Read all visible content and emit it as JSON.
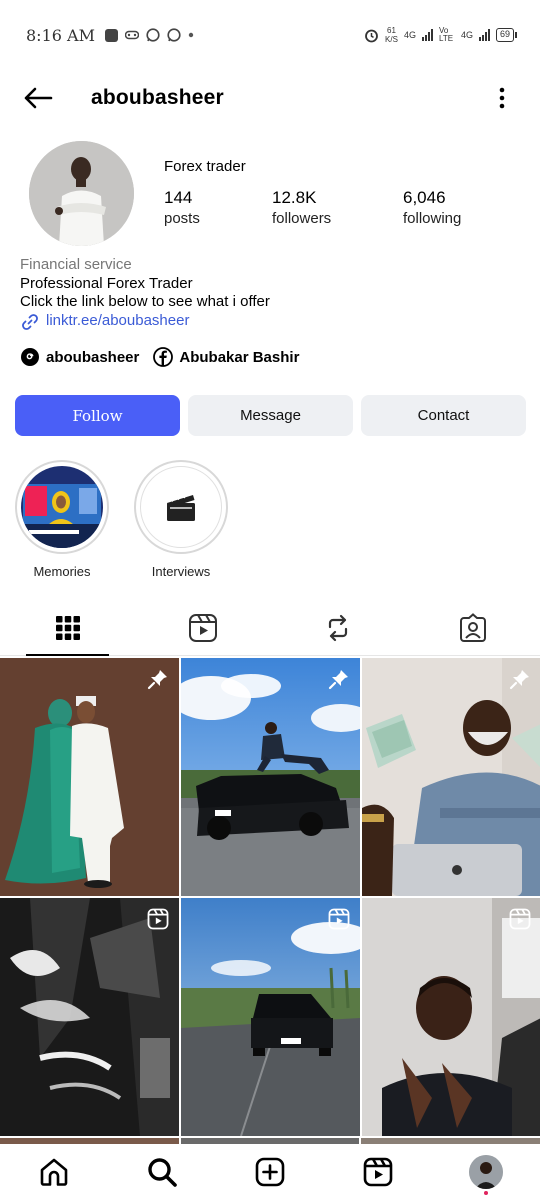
{
  "status_bar": {
    "time": "8:16 AM",
    "net_speed_value": "61",
    "net_speed_unit": "K/S",
    "network_1": "4G",
    "volte": "Vo LTE",
    "network_2": "4G",
    "battery": "69"
  },
  "header": {
    "username": "aboubasheer",
    "back_icon": "arrow-left-icon",
    "more_icon": "vertical-dots-icon"
  },
  "profile": {
    "name": "Forex trader",
    "stats": [
      {
        "count": "144",
        "label": "posts"
      },
      {
        "count": "12.8K",
        "label": "followers"
      },
      {
        "count": "6,046",
        "label": "following"
      }
    ],
    "category": "Financial service",
    "bio_line_1": "Professional Forex Trader",
    "bio_line_2": "Click the link below to see what i offer",
    "link": "linktr.ee/aboubasheer"
  },
  "socials": {
    "threads_name": "aboubasheer",
    "facebook_name": "Abubakar Bashir"
  },
  "actions": {
    "follow": "Follow",
    "message": "Message",
    "contact": "Contact"
  },
  "highlights": [
    {
      "label": "Memories"
    },
    {
      "label": "Interviews"
    }
  ],
  "tabs": [
    "grid-icon",
    "reels-icon",
    "reposts-icon",
    "tagged-icon"
  ],
  "colors": {
    "follow_button": "#4a5ff7",
    "link": "#3b5bd6",
    "secondary_button": "#eef0f3"
  }
}
